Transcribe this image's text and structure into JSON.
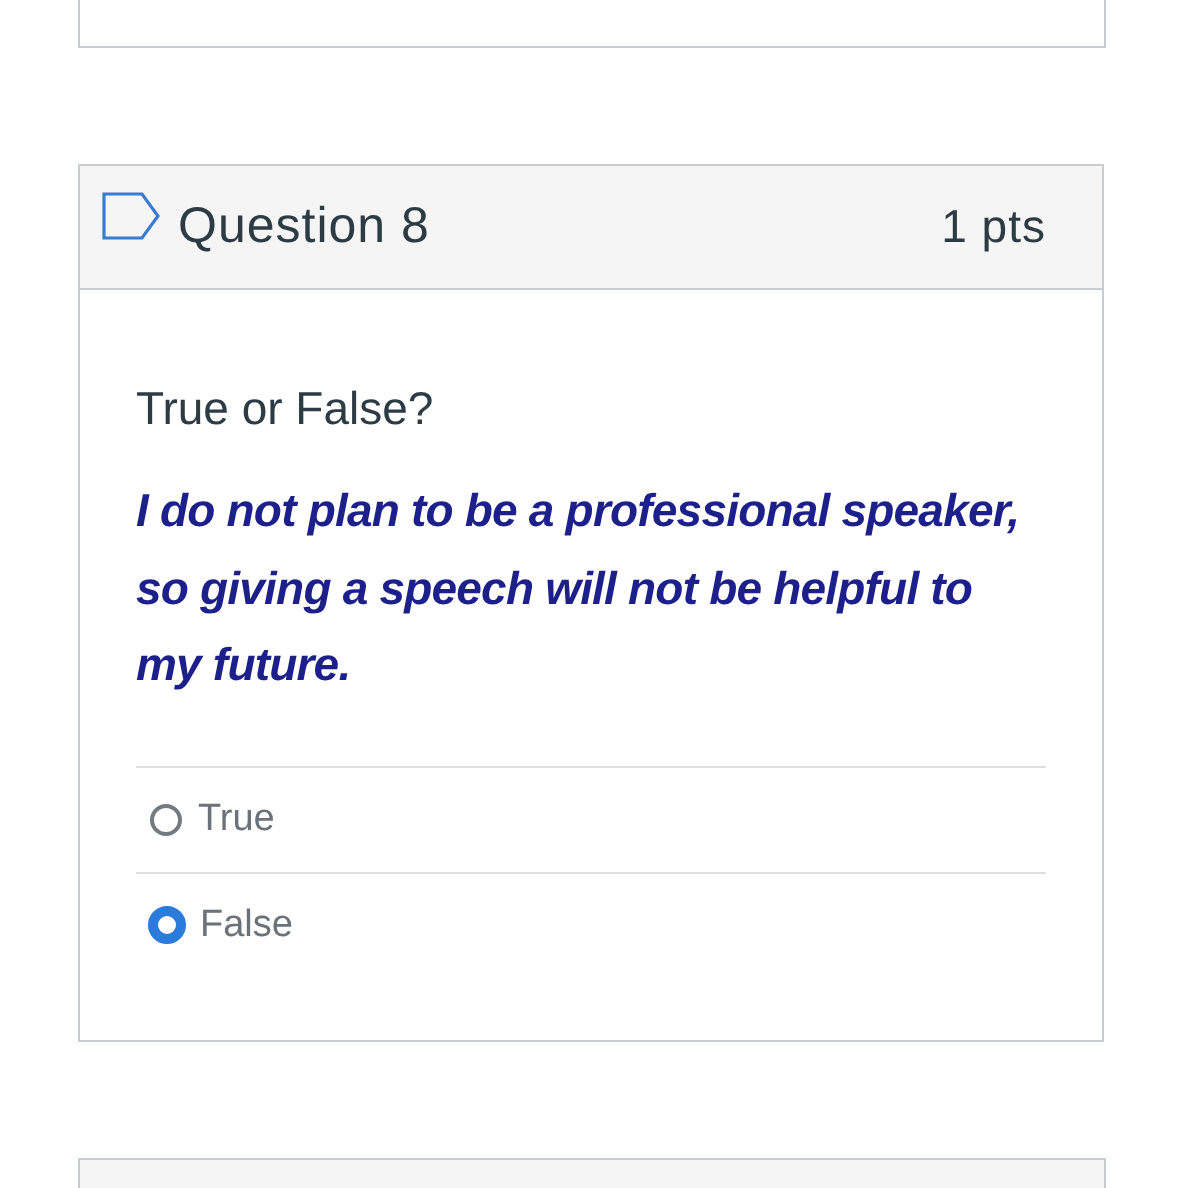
{
  "question": {
    "title": "Question 8",
    "points": "1 pts",
    "flagged": false,
    "prompt": "True or False?",
    "statement": "I do not plan to be a professional speaker, so giving a speech will not be helpful to my future.",
    "answers": [
      {
        "label": "True",
        "selected": false
      },
      {
        "label": "False",
        "selected": true
      }
    ]
  }
}
